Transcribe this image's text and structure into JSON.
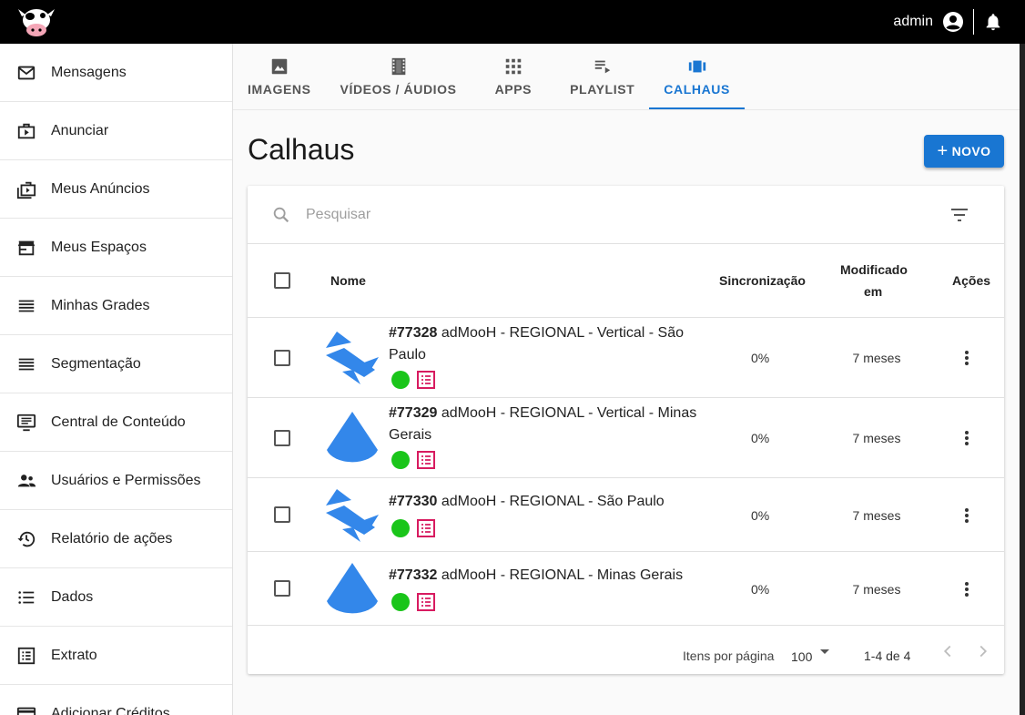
{
  "header": {
    "user_name": "admin"
  },
  "sidebar": {
    "items": [
      {
        "label": "Mensagens",
        "icon": "mail-icon"
      },
      {
        "label": "Anunciar",
        "icon": "ad-briefcase-icon"
      },
      {
        "label": "Meus Anúncios",
        "icon": "ads-stack-icon"
      },
      {
        "label": "Meus Espaços",
        "icon": "store-icon"
      },
      {
        "label": "Minhas Grades",
        "icon": "lines-icon"
      },
      {
        "label": "Segmentação",
        "icon": "lines-icon"
      },
      {
        "label": "Central de Conteúdo",
        "icon": "monitor-list-icon"
      },
      {
        "label": "Usuários e Permissões",
        "icon": "people-icon"
      },
      {
        "label": "Relatório de ações",
        "icon": "history-icon"
      },
      {
        "label": "Dados",
        "icon": "list-icon"
      },
      {
        "label": "Extrato",
        "icon": "receipt-icon"
      },
      {
        "label": "Adicionar Créditos",
        "icon": "credit-card-icon"
      }
    ]
  },
  "tabs": [
    {
      "label": "IMAGENS",
      "icon": "image-icon",
      "active": false
    },
    {
      "label": "VÍDEOS / ÁUDIOS",
      "icon": "film-icon",
      "active": false
    },
    {
      "label": "APPS",
      "icon": "apps-grid-icon",
      "active": false
    },
    {
      "label": "PLAYLIST",
      "icon": "playlist-icon",
      "active": false
    },
    {
      "label": "CALHAUS",
      "icon": "carousel-icon",
      "active": true
    }
  ],
  "page": {
    "title": "Calhaus",
    "new_button": "NOVO"
  },
  "search": {
    "placeholder": "Pesquisar"
  },
  "table": {
    "headers": {
      "name": "Nome",
      "sync": "Sincronização",
      "modified_1": "Modificado",
      "modified_2": "em",
      "actions": "Ações"
    },
    "rows": [
      {
        "id": "#77328",
        "title": "adMooH - REGIONAL - Vertical - São Paulo",
        "thumb": "shuffle-shape",
        "sync": "0%",
        "modified": "7 meses",
        "status": "green"
      },
      {
        "id": "#77329",
        "title": "adMooH - REGIONAL - Vertical - Minas Gerais",
        "thumb": "drop-shape",
        "sync": "0%",
        "modified": "7 meses",
        "status": "green"
      },
      {
        "id": "#77330",
        "title": "adMooH - REGIONAL - São Paulo",
        "thumb": "shuffle-shape",
        "sync": "0%",
        "modified": "7 meses",
        "status": "green"
      },
      {
        "id": "#77332",
        "title": "adMooH - REGIONAL - Minas Gerais",
        "thumb": "drop-shape",
        "sync": "0%",
        "modified": "7 meses",
        "status": "green"
      }
    ]
  },
  "pagination": {
    "per_page_label": "Itens por página",
    "per_page_value": "100",
    "range": "1-4 de 4"
  },
  "colors": {
    "accent": "#1976d2",
    "status_ok": "#1ac51a",
    "grid_badge": "#d81b60"
  }
}
